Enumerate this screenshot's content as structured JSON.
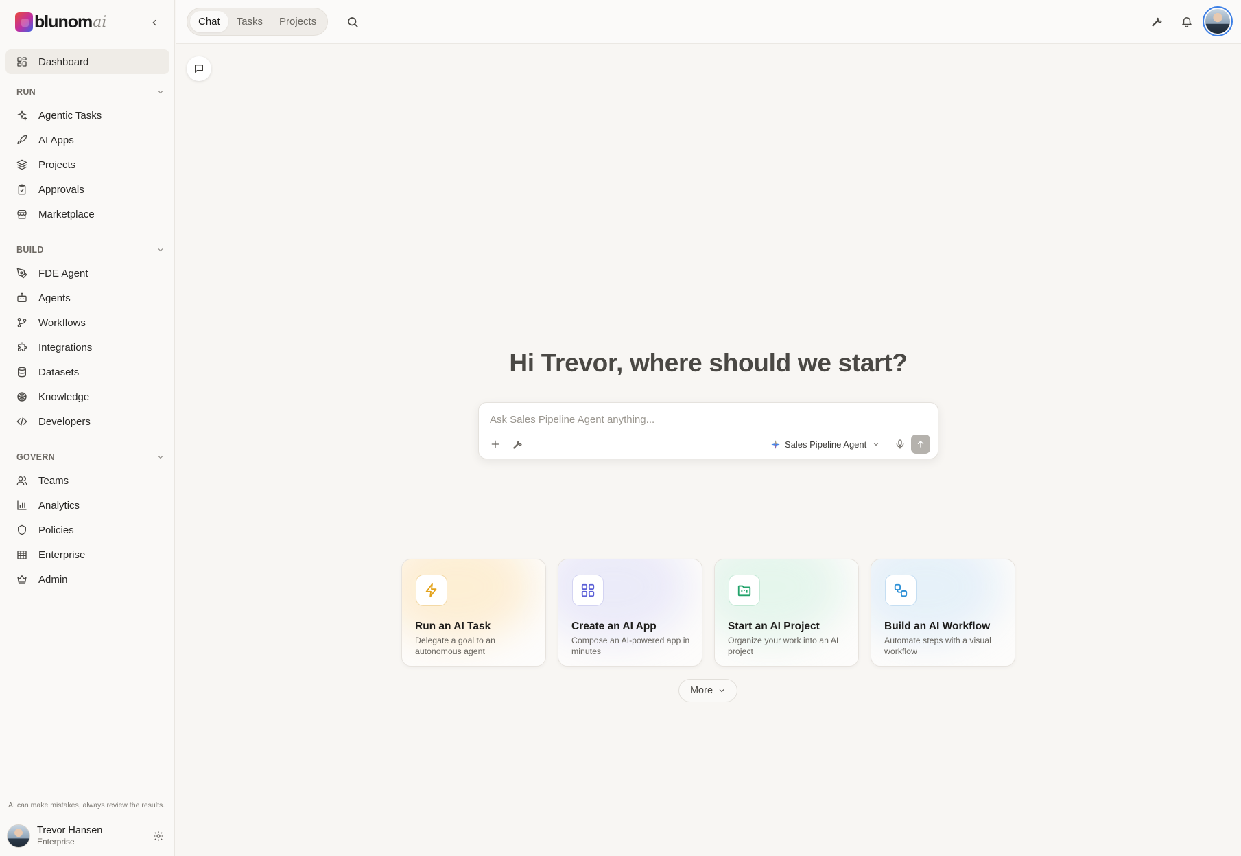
{
  "brand": {
    "name": "blunom",
    "suffix": "ai"
  },
  "sidebar": {
    "dashboard": "Dashboard",
    "sections": [
      {
        "title": "RUN",
        "items": [
          "Agentic Tasks",
          "AI Apps",
          "Projects",
          "Approvals",
          "Marketplace"
        ]
      },
      {
        "title": "BUILD",
        "items": [
          "FDE Agent",
          "Agents",
          "Workflows",
          "Integrations",
          "Datasets",
          "Knowledge",
          "Developers"
        ]
      },
      {
        "title": "GOVERN",
        "items": [
          "Teams",
          "Analytics",
          "Policies",
          "Enterprise",
          "Admin"
        ]
      }
    ],
    "disclaimer": "AI can make mistakes, always review the results.",
    "user": {
      "name": "Trevor Hansen",
      "plan": "Enterprise"
    }
  },
  "header": {
    "tabs": [
      "Chat",
      "Tasks",
      "Projects"
    ],
    "active_tab": "Chat"
  },
  "main": {
    "greeting": "Hi Trevor, where should we start?",
    "composer": {
      "placeholder": "Ask Sales Pipeline Agent anything...",
      "agent": "Sales Pipeline Agent"
    },
    "cards": [
      {
        "title": "Run an AI Task",
        "desc": "Delegate a goal to an autonomous agent",
        "color": "#e3a21a"
      },
      {
        "title": "Create an AI App",
        "desc": "Compose an AI-powered app in minutes",
        "color": "#5b5fd6"
      },
      {
        "title": "Start an AI Project",
        "desc": "Organize your work into an AI project",
        "color": "#23a36b"
      },
      {
        "title": "Build an AI Workflow",
        "desc": "Automate steps with a visual workflow",
        "color": "#2b8fd6"
      }
    ],
    "more_label": "More"
  },
  "colors": {
    "accent": "#3c7fe6",
    "background": "#f8f6f3",
    "sidebar": "#faf9f7"
  }
}
